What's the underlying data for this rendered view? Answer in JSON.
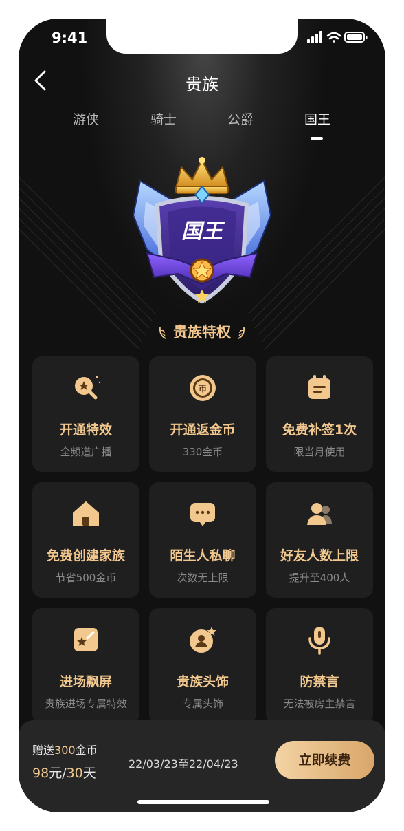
{
  "status_bar": {
    "time": "9:41"
  },
  "nav": {
    "title": "贵族"
  },
  "tabs": [
    {
      "label": "游侠",
      "active": false
    },
    {
      "label": "骑士",
      "active": false
    },
    {
      "label": "公爵",
      "active": false
    },
    {
      "label": "国王",
      "active": true
    }
  ],
  "badge": {
    "text": "国王"
  },
  "section": {
    "title": "贵族特权"
  },
  "privileges": [
    {
      "title": "开通特效",
      "subtitle": "全频道广播",
      "icon": "magnifier-star-icon"
    },
    {
      "title": "开通返金币",
      "subtitle": "330金币",
      "icon": "coin-icon"
    },
    {
      "title": "免费补签1次",
      "subtitle": "限当月使用",
      "icon": "calendar-icon"
    },
    {
      "title": "免费创建家族",
      "subtitle": "节省500金币",
      "icon": "house-icon"
    },
    {
      "title": "陌生人私聊",
      "subtitle": "次数无上限",
      "icon": "chat-bubble-icon"
    },
    {
      "title": "好友人数上限",
      "subtitle": "提升至400人",
      "icon": "friends-icon"
    },
    {
      "title": "进场飘屏",
      "subtitle": "贵族进场专属特效",
      "icon": "entrance-effect-icon"
    },
    {
      "title": "贵族头饰",
      "subtitle": "专属头饰",
      "icon": "avatar-frame-icon"
    },
    {
      "title": "防禁言",
      "subtitle": "无法被房主禁言",
      "icon": "microphone-icon"
    }
  ],
  "bottom": {
    "gift_prefix": "赠送",
    "gift_amount": "300",
    "gift_suffix": "金币",
    "price_amount": "98",
    "price_mid": "元/",
    "price_days": "30",
    "price_suffix": "天",
    "date_range": "22/03/23至22/04/23",
    "renew_label": "立即续费"
  },
  "colors": {
    "accent": "#f2c88f",
    "background": "#111111",
    "card": "#1f1f1f"
  }
}
